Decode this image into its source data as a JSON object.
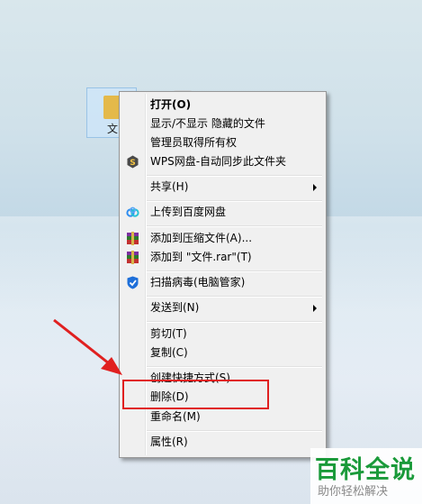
{
  "desktop": {
    "file_label": "文",
    "background_colors": [
      "#d9e7ec",
      "#c2d8e6",
      "#e7eef5"
    ]
  },
  "context_menu": {
    "items": [
      {
        "label": "打开(O)",
        "bold": true
      },
      {
        "label": "显示/不显示 隐藏的文件"
      },
      {
        "label": "管理员取得所有权"
      },
      {
        "label": "WPS网盘-自动同步此文件夹",
        "icon": "wps-cloud-icon"
      },
      {
        "label": "共享(H)",
        "submenu": true
      },
      {
        "label": "上传到百度网盘",
        "icon": "baidu-netdisk-icon"
      },
      {
        "label": "添加到压缩文件(A)...",
        "icon": "winrar-icon"
      },
      {
        "label": "添加到 \"文件.rar\"(T)",
        "icon": "winrar-icon"
      },
      {
        "label": "扫描病毒(电脑管家)",
        "icon": "tencent-pcmgr-icon"
      },
      {
        "label": "发送到(N)",
        "submenu": true
      },
      {
        "label": "剪切(T)"
      },
      {
        "label": "复制(C)"
      },
      {
        "label": "创建快捷方式(S)"
      },
      {
        "label": "删除(D)",
        "highlighted": true
      },
      {
        "label": "重命名(M)"
      },
      {
        "label": "属性(R)"
      }
    ]
  },
  "annotation": {
    "arrow_color": "#e02020",
    "box_color": "#e02020",
    "target": "删除(D)"
  },
  "watermark": {
    "title": "百科全说",
    "subtitle": "助你轻松解决",
    "color": "#1a9a3a"
  }
}
